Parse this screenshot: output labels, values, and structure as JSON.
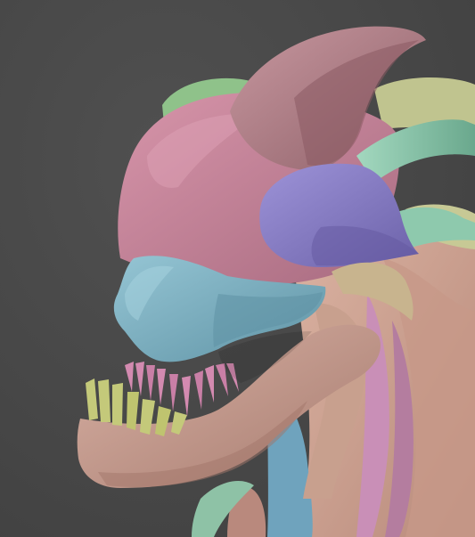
{
  "scene": {
    "background": "#474747",
    "subject": "",
    "polygroup_colors": {
      "skull_cap": "#c9859b",
      "horn_rear": "#b7858e",
      "face_bone": "#7fb2c3",
      "jaw": "#c9a093",
      "teeth_lower": "#c4c97a",
      "teeth_upper": "#d38ab0",
      "spike_purple": "#8a7fc9",
      "spike_mint": "#8ec9ad",
      "spike_green": "#8fc28a",
      "spike_olive": "#c0c48f",
      "spike_tan": "#c8b48e",
      "neck_pink": "#c98fb7",
      "neck_blue": "#6fa3bd",
      "body_peach": "#d3a796"
    },
    "icons": []
  }
}
